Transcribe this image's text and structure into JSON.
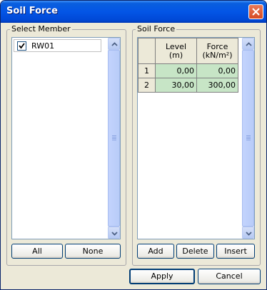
{
  "window": {
    "title": "Soil Force"
  },
  "select_member": {
    "legend": "Select Member",
    "items": [
      {
        "label": "RW01",
        "checked": true
      }
    ],
    "buttons": {
      "all": "All",
      "none": "None"
    }
  },
  "soil_force": {
    "legend": "Soil Force",
    "columns": [
      {
        "name": "Level",
        "unit": "(m)"
      },
      {
        "name": "Force",
        "unit": "(kN/m²)"
      }
    ],
    "rows": [
      {
        "index": "1",
        "level": "0,00",
        "force": "0,00"
      },
      {
        "index": "2",
        "level": "30,00",
        "force": "300,00"
      }
    ],
    "buttons": {
      "add": "Add",
      "delete": "Delete",
      "insert": "Insert"
    }
  },
  "footer": {
    "apply": "Apply",
    "cancel": "Cancel"
  },
  "colors": {
    "titlebar": "#0355e6",
    "grid_cell": "#c7e5c6",
    "dialog_bg": "#ece9d8"
  }
}
